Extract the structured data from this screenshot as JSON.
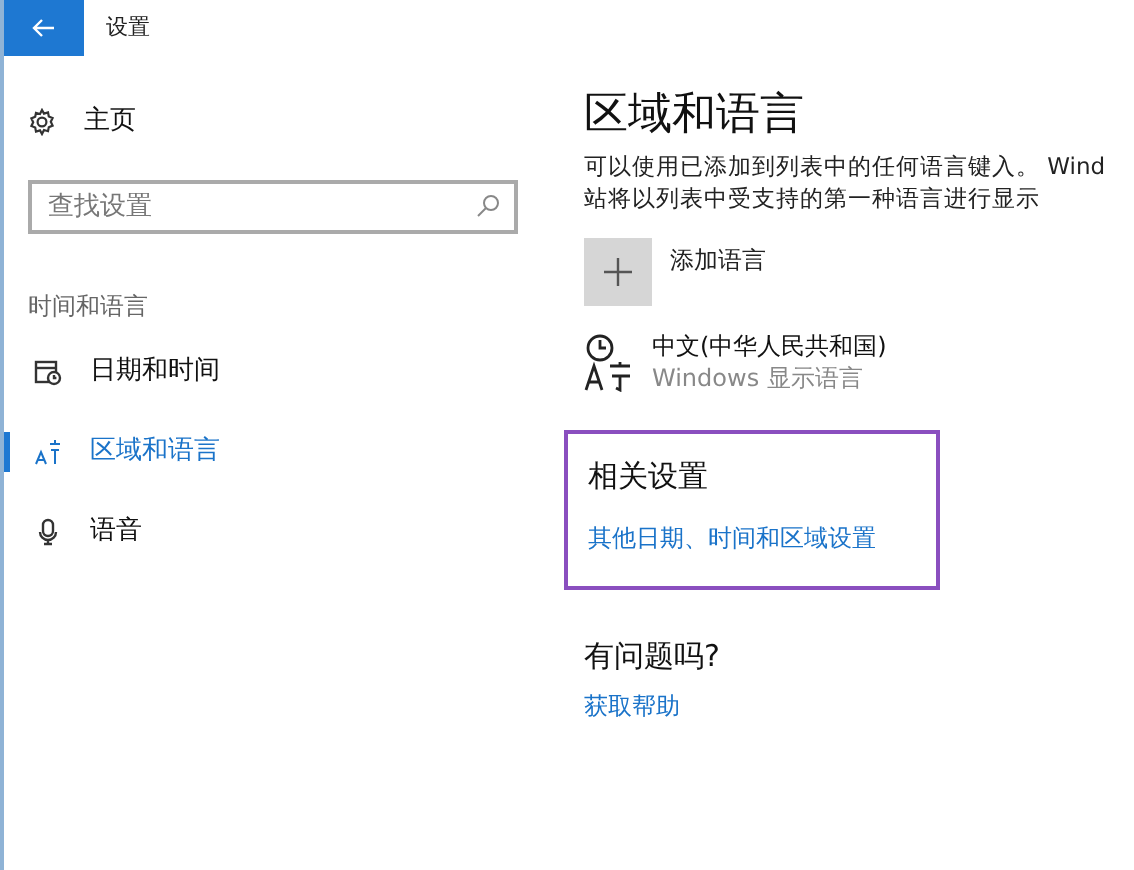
{
  "window": {
    "title": "设置"
  },
  "sidebar": {
    "home": "主页",
    "search": {
      "placeholder": "查找设置"
    },
    "group": "时间和语言",
    "items": [
      {
        "label": "日期和时间",
        "kind": "calendar",
        "selected": false
      },
      {
        "label": "区域和语言",
        "kind": "language",
        "selected": true
      },
      {
        "label": "语音",
        "kind": "mic",
        "selected": false
      }
    ]
  },
  "content": {
    "title": "区域和语言",
    "description": [
      "可以使用已添加到列表中的任何语言键入。 Wind",
      "站将以列表中受支持的第一种语言进行显示"
    ],
    "add_language": "添加语言",
    "languages": [
      {
        "name": "中文(中华人民共和国)",
        "note": "Windows 显示语言"
      }
    ],
    "related": {
      "title": "相关设置",
      "link": "其他日期、时间和区域设置",
      "highlighted": true
    },
    "help": {
      "title": "有问题吗?",
      "link": "获取帮助"
    }
  }
}
